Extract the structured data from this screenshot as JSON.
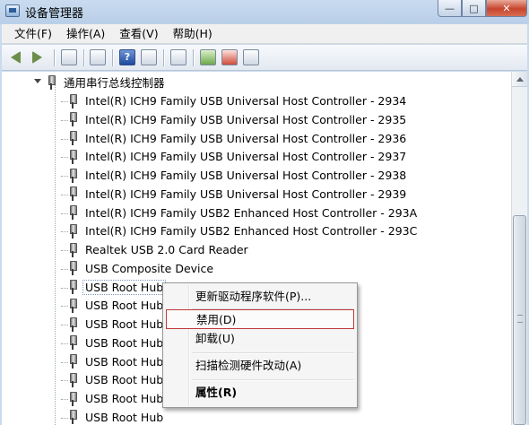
{
  "window": {
    "title": "设备管理器",
    "min_glyph": "—",
    "max_glyph": "□",
    "close_glyph": "✕"
  },
  "menubar": [
    {
      "label": "文件(F)"
    },
    {
      "label": "操作(A)"
    },
    {
      "label": "查看(V)"
    },
    {
      "label": "帮助(H)"
    }
  ],
  "toolbar": {
    "buttons": [
      "back-icon",
      "forward-icon",
      "show-hide-tree-icon",
      "properties-icon",
      "help-icon",
      "view-icon",
      "monitor-icon",
      "update-driver-icon",
      "uninstall-icon",
      "scan-hardware-icon"
    ],
    "help_glyph": "?"
  },
  "tree": {
    "category": "通用串行总线控制器",
    "devices": [
      "Intel(R) ICH9 Family USB Universal Host Controller - 2934",
      "Intel(R) ICH9 Family USB Universal Host Controller - 2935",
      "Intel(R) ICH9 Family USB Universal Host Controller - 2936",
      "Intel(R) ICH9 Family USB Universal Host Controller - 2937",
      "Intel(R) ICH9 Family USB Universal Host Controller - 2938",
      "Intel(R) ICH9 Family USB Universal Host Controller - 2939",
      "Intel(R) ICH9 Family USB2 Enhanced Host Controller - 293A",
      "Intel(R) ICH9 Family USB2 Enhanced Host Controller - 293C",
      "Realtek USB 2.0 Card Reader",
      "USB Composite Device",
      "USB Root Hub",
      "USB Root Hub",
      "USB Root Hub",
      "USB Root Hub",
      "USB Root Hub",
      "USB Root Hub",
      "USB Root Hub",
      "USB Root Hub"
    ],
    "selected_index": 10
  },
  "context_menu": {
    "update_driver": "更新驱动程序软件(P)...",
    "disable": "禁用(D)",
    "uninstall": "卸载(U)",
    "scan": "扫描检测硬件改动(A)",
    "properties": "属性(R)",
    "highlight_color": "#c0393b"
  }
}
